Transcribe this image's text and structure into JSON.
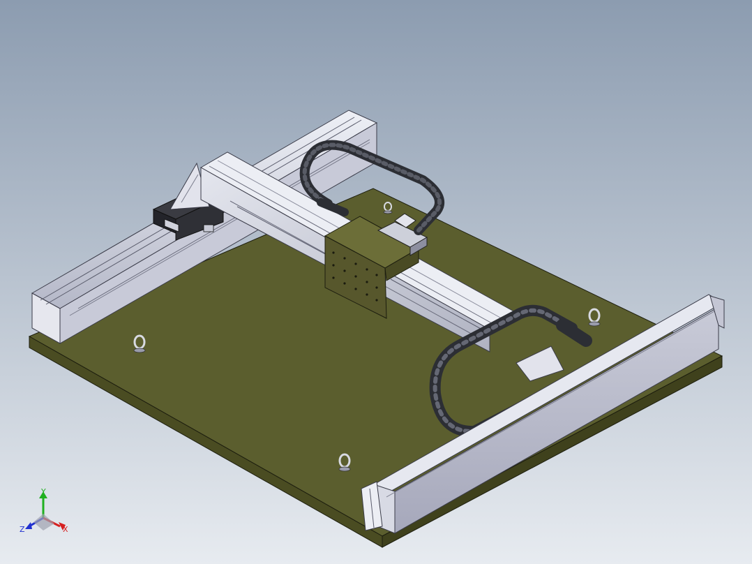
{
  "viewport": {
    "background_top": "#8c9cb0",
    "background_bottom": "#e7ebf0"
  },
  "model": {
    "base_plate_color": "#5b5e2e",
    "rail_color": "#d6d8e4",
    "carriage_color": "#57572c",
    "cable_chain_color": "#2c2e34"
  },
  "triad": {
    "x_label": "X",
    "y_label": "Y",
    "z_label": "Z",
    "x_color": "#d62020",
    "y_color": "#20b020",
    "z_color": "#2030d0"
  }
}
